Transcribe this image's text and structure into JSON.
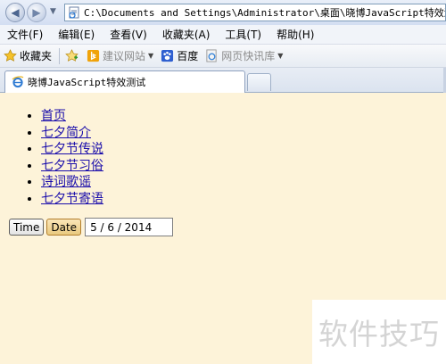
{
  "browser": {
    "address": "C:\\Documents and Settings\\Administrator\\桌面\\晓博JavaScript特效测试.html",
    "menu": [
      "文件(F)",
      "编辑(E)",
      "查看(V)",
      "收藏夹(A)",
      "工具(T)",
      "帮助(H)"
    ],
    "favorites": {
      "label": "收藏夹",
      "items": [
        {
          "label": "建议网站",
          "icon": "bing-icon"
        },
        {
          "label": "百度",
          "icon": "baidu-paw-icon"
        },
        {
          "label": "网页快讯库",
          "icon": "web-slice-icon"
        }
      ]
    },
    "tab_title": "晓博JavaScript特效测试"
  },
  "page": {
    "nav_links": [
      "首页",
      "七夕简介",
      "七夕节传说",
      "七夕节习俗",
      "诗词歌谣",
      "七夕节寄语"
    ],
    "time_button": "Time",
    "date_button": "Date",
    "date_value": "5 / 6 / 2014"
  },
  "watermark": "软件技巧",
  "colors": {
    "page_background": "#fdf3d9",
    "link": "#1a0dab",
    "chrome": "#e3e9f4"
  }
}
